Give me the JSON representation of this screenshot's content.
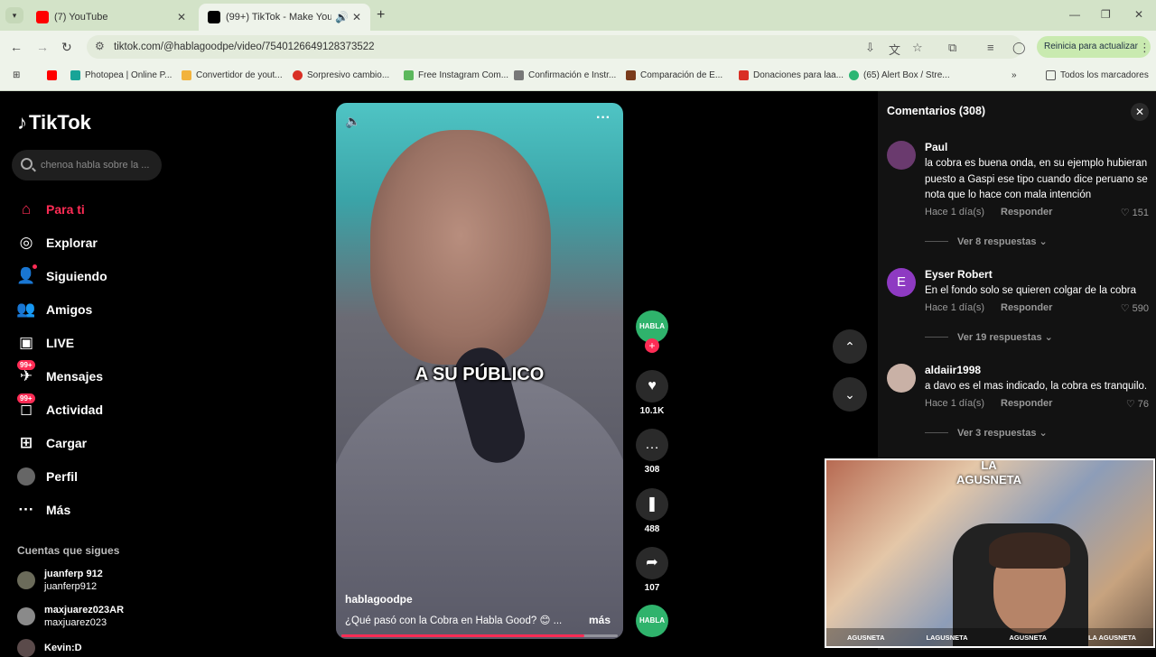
{
  "browser": {
    "tabs": [
      {
        "title": "(7) YouTube",
        "color": "#ff0000"
      },
      {
        "title": "(99+) TikTok - Make Your Day",
        "color": "#000000"
      }
    ],
    "new_tab": "+",
    "url": "tiktok.com/@hablagoodpe/video/7540126649128373522",
    "update_button": "Reinicia para actualizar",
    "bookmarks": [
      {
        "label": "",
        "color": "#ff0000"
      },
      {
        "label": "Photopea | Online P...",
        "color": "#18a497"
      },
      {
        "label": "Convertidor de yout...",
        "color": "#f2b33d"
      },
      {
        "label": "Sorpresivo cambio...",
        "color": "#d93025"
      },
      {
        "label": "Free Instagram Com...",
        "color": "#5cb85c"
      },
      {
        "label": "Confirmación e Instr...",
        "color": "#777777"
      },
      {
        "label": "Comparación de E...",
        "color": "#7a3b1b"
      },
      {
        "label": "Donaciones para laa...",
        "color": "#d93025"
      },
      {
        "label": "(65) Alert Box / Stre...",
        "color": "#2bb673"
      }
    ],
    "all_bookmarks": "Todos los marcadores"
  },
  "sidebar": {
    "logo": "TikTok",
    "search_placeholder": "chenoa habla sobre la ...",
    "nav": [
      {
        "label": "Para ti",
        "icon": "home-icon"
      },
      {
        "label": "Explorar",
        "icon": "compass-icon"
      },
      {
        "label": "Siguiendo",
        "icon": "following-icon"
      },
      {
        "label": "Amigos",
        "icon": "friends-icon"
      },
      {
        "label": "LIVE",
        "icon": "live-icon"
      },
      {
        "label": "Mensajes",
        "icon": "messages-icon",
        "badge": "99+"
      },
      {
        "label": "Actividad",
        "icon": "activity-icon",
        "badge": "99+"
      },
      {
        "label": "Cargar",
        "icon": "upload-icon"
      },
      {
        "label": "Perfil",
        "icon": "profile-icon"
      },
      {
        "label": "Más",
        "icon": "more-icon"
      }
    ],
    "following_title": "Cuentas que sigues",
    "following": [
      {
        "name": "juanferp 912",
        "handle": "juanferp912"
      },
      {
        "name": "maxjuarez023AR",
        "handle": "maxjuarez023"
      },
      {
        "name": "Kevin:D",
        "handle": ""
      }
    ]
  },
  "video": {
    "caption": "A SU PÚBLICO",
    "username": "hablagoodpe",
    "description": "¿Qué pasó con la Cobra en Habla Good? 😊 ...",
    "more": "más",
    "progress": 0.88,
    "avatar_text": "HABLA",
    "likes": "10.1K",
    "comments": "308",
    "saves": "488",
    "shares": "107"
  },
  "comments": {
    "title": "Comentarios (308)",
    "items": [
      {
        "name": "Paul",
        "text": "la cobra es buena onda, en su ejemplo hubieran puesto a Gaspi ese tipo cuando dice peruano se nota que lo hace con mala intención",
        "meta": "Hace 1 día(s)",
        "reply": "Responder",
        "likes": "151",
        "view": "Ver 8 respuestas",
        "avatar_color": "#6a3a6e"
      },
      {
        "name": "Eyser Robert",
        "text": "En el fondo solo se quieren colgar de la cobra",
        "meta": "Hace 1 día(s)",
        "reply": "Responder",
        "likes": "590",
        "view": "Ver 19 respuestas",
        "avatar_color": "#8e3ac2",
        "initial": "E"
      },
      {
        "name": "aldaiir1998",
        "text": "a davo es el mas indicado, la cobra es tranquilo.",
        "meta": "Hace 1 día(s)",
        "reply": "Responder",
        "likes": "76",
        "view": "Ver 3 respuestas",
        "avatar_color": "#c9b1a6"
      }
    ]
  },
  "webcam": {
    "logo": "LA AGUSNETA",
    "bar": [
      "AGUSNETA",
      "LAGUSNETA",
      "AGUSNETA",
      "LA AGUSNETA"
    ]
  }
}
